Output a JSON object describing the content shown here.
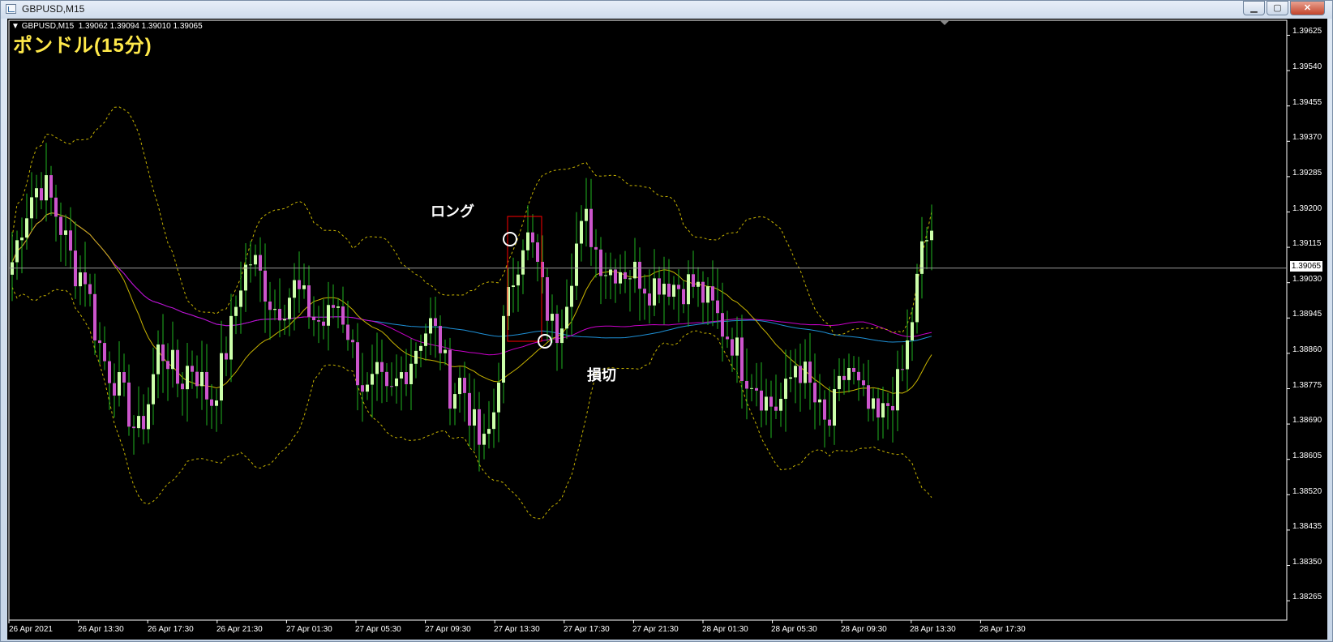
{
  "window": {
    "title": "GBPUSD,M15",
    "buttons": [
      "minimize",
      "maximize",
      "close"
    ]
  },
  "chart": {
    "symbol_info": "GBPUSD,M15  1.39062 1.39094 1.39010 1.39065",
    "overlay_title": "ポンドル(15分)",
    "annotations": {
      "long": "ロング",
      "stop_loss": "損切"
    },
    "current_price_label": "1.39065",
    "colors": {
      "background": "#000000",
      "bull_candle": "#ccffaa",
      "bear_candle": "#cc55cc",
      "wick": "#1fb51f",
      "bollinger": "#c8b400",
      "ma_short": "#c8b400",
      "ma_mid": "#cc00cc",
      "ma_long": "#1e90d6",
      "rectangle": "#ff0000"
    }
  },
  "chart_data": {
    "type": "candlestick",
    "y_axis_ticks": [
      "1.39625",
      "1.39540",
      "1.39455",
      "1.39370",
      "1.39285",
      "1.39200",
      "1.39115",
      "1.39030",
      "1.38945",
      "1.38860",
      "1.38775",
      "1.38690",
      "1.38605",
      "1.38520",
      "1.38435",
      "1.38350",
      "1.38265"
    ],
    "x_axis_ticks": [
      "26 Apr 2021",
      "26 Apr 13:30",
      "26 Apr 17:30",
      "26 Apr 21:30",
      "27 Apr 01:30",
      "27 Apr 05:30",
      "27 Apr 09:30",
      "27 Apr 13:30",
      "27 Apr 17:30",
      "27 Apr 21:30",
      "28 Apr 01:30",
      "28 Apr 05:30",
      "28 Apr 09:30",
      "28 Apr 13:30",
      "28 Apr 17:30"
    ],
    "ylim": [
      1.3822,
      1.3966
    ],
    "current_price": 1.39065,
    "ohlc_shape": [
      1.3908,
      1.3918,
      1.3925,
      1.3927,
      1.3921,
      1.3914,
      1.3906,
      1.3905,
      1.3891,
      1.3883,
      1.3879,
      1.3873,
      1.3866,
      1.3874,
      1.3887,
      1.3885,
      1.3878,
      1.3884,
      1.388,
      1.3874,
      1.3882,
      1.3892,
      1.3905,
      1.3909,
      1.3903,
      1.3897,
      1.3898,
      1.3902,
      1.3898,
      1.3894,
      1.3893,
      1.3899,
      1.3893,
      1.3882,
      1.3876,
      1.388,
      1.3874,
      1.388,
      1.3884,
      1.389,
      1.3893,
      1.3888,
      1.3876,
      1.388,
      1.387,
      1.3862,
      1.387,
      1.3892,
      1.3905,
      1.3915,
      1.391,
      1.3898,
      1.389,
      1.39,
      1.3912,
      1.3918,
      1.391,
      1.3906,
      1.3907,
      1.3906,
      1.3905,
      1.3902,
      1.3904,
      1.3903,
      1.3902,
      1.3903,
      1.39,
      1.3897,
      1.3892,
      1.3889,
      1.3882,
      1.388,
      1.3875,
      1.3873,
      1.3876,
      1.3884,
      1.388,
      1.3873,
      1.3867,
      1.3876,
      1.3883,
      1.3877,
      1.3872,
      1.3869,
      1.3875,
      1.3879,
      1.3892,
      1.391,
      1.3916
    ]
  }
}
